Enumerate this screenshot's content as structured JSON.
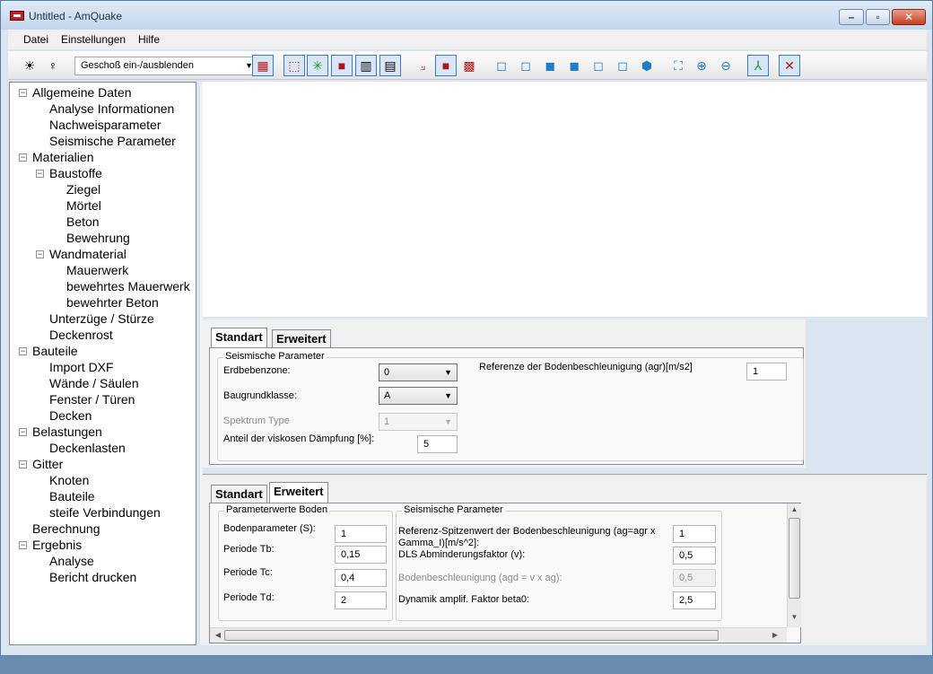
{
  "window": {
    "title": "Untitled - AmQuake",
    "min_icon": "minimize-icon",
    "max_icon": "maximize-icon",
    "close_icon": "close-icon"
  },
  "menu": [
    "Datei",
    "Einstellungen",
    "Hilfe"
  ],
  "toolbar": {
    "floor_combo": "Geschoß ein-/ausblenden",
    "icons": [
      "bug-icon",
      "bulb-icon",
      "wall-grid-icon",
      "select-frame-icon",
      "node-star-icon",
      "cube-red-icon",
      "cube-wire-icon",
      "cube-wire2-icon",
      "axis-icon",
      "cube-solid-icon",
      "cube-outline-icon",
      "view-front-icon",
      "view-back-icon",
      "view-left-icon",
      "view-right-icon",
      "view-top-icon",
      "view-bottom-icon",
      "view-iso-icon",
      "zoom-fit-icon",
      "zoom-in-icon",
      "zoom-out-icon",
      "coord-axes-icon",
      "cross-point-icon"
    ]
  },
  "tree": [
    {
      "label": "Allgemeine Daten",
      "level": 0,
      "expander": "⊟"
    },
    {
      "label": "Analyse Informationen",
      "level": 1
    },
    {
      "label": "Nachweisparameter",
      "level": 1
    },
    {
      "label": "Seismische Parameter",
      "level": 1,
      "selected": true
    },
    {
      "label": "Materialien",
      "level": 0,
      "expander": "⊟"
    },
    {
      "label": "Baustoffe",
      "level": 1,
      "expander": "⊟"
    },
    {
      "label": "Ziegel",
      "level": 2
    },
    {
      "label": "Mörtel",
      "level": 2
    },
    {
      "label": "Beton",
      "level": 2
    },
    {
      "label": "Bewehrung",
      "level": 2
    },
    {
      "label": "Wandmaterial",
      "level": 1,
      "expander": "⊟"
    },
    {
      "label": "Mauerwerk",
      "level": 2
    },
    {
      "label": "bewehrtes Mauerwerk",
      "level": 2
    },
    {
      "label": "bewehrter Beton",
      "level": 2
    },
    {
      "label": "Unterzüge / Stürze",
      "level": 1
    },
    {
      "label": "Deckenrost",
      "level": 1
    },
    {
      "label": "Bauteile",
      "level": 0,
      "expander": "⊟"
    },
    {
      "label": "Import DXF",
      "level": 1
    },
    {
      "label": "Wände / Säulen",
      "level": 1
    },
    {
      "label": "Fenster / Türen",
      "level": 1
    },
    {
      "label": "Decken",
      "level": 1
    },
    {
      "label": "Belastungen",
      "level": 0,
      "expander": "⊟"
    },
    {
      "label": "Deckenlasten",
      "level": 1
    },
    {
      "label": "Gitter",
      "level": 0,
      "expander": "⊟"
    },
    {
      "label": "Knoten",
      "level": 1
    },
    {
      "label": "Bauteile",
      "level": 1
    },
    {
      "label": "steife Verbindungen",
      "level": 1
    },
    {
      "label": "Berechnung",
      "level": 0
    },
    {
      "label": "Ergebnis",
      "level": 0,
      "expander": "⊟"
    },
    {
      "label": "Analyse",
      "level": 1
    },
    {
      "label": "Bericht drucken",
      "level": 1
    }
  ],
  "panel1": {
    "tabs": [
      "Standart",
      "Erweitert"
    ],
    "group_title": "Seismische Parameter",
    "erdbebenzone_label": "Erdbebenzone:",
    "erdbebenzone_value": "0",
    "baugrund_label": "Baugrundklasse:",
    "baugrund_value": "A",
    "spektrum_label": "Spektrum Type",
    "spektrum_value": "1",
    "daempfung_label": "Anteil der viskosen Dämpfung [%]:",
    "daempfung_value": "5",
    "agr_label": "Referenze der Bodenbeschleunigung (agr)[m/s2]",
    "agr_value": "1"
  },
  "panel2": {
    "tabs": [
      "Standart",
      "Erweitert"
    ],
    "boden_group": "Parameterwerte Boden",
    "s_label": "Bodenparameter (S):",
    "s_value": "1",
    "tb_label": "Periode Tb:",
    "tb_value": "0,15",
    "tc_label": "Periode Tc:",
    "tc_value": "0,4",
    "td_label": "Periode Td:",
    "td_value": "2",
    "seis_group": "Seismische Parameter",
    "ag_label_1": "Referenz-Spitzenwert der Bodenbeschleunigung (ag=agr x",
    "ag_label_2": "Gamma_I)[m/s^2]:",
    "ag_value": "1",
    "dls_label": "DLS Abminderungsfaktor (v):",
    "dls_value": "0,5",
    "agd_label": "Bodenbeschleunigung (agd = v x ag):",
    "agd_value": "0,5",
    "beta_label": "Dynamik amplif. Faktor beta0:",
    "beta_value": "2,5"
  }
}
